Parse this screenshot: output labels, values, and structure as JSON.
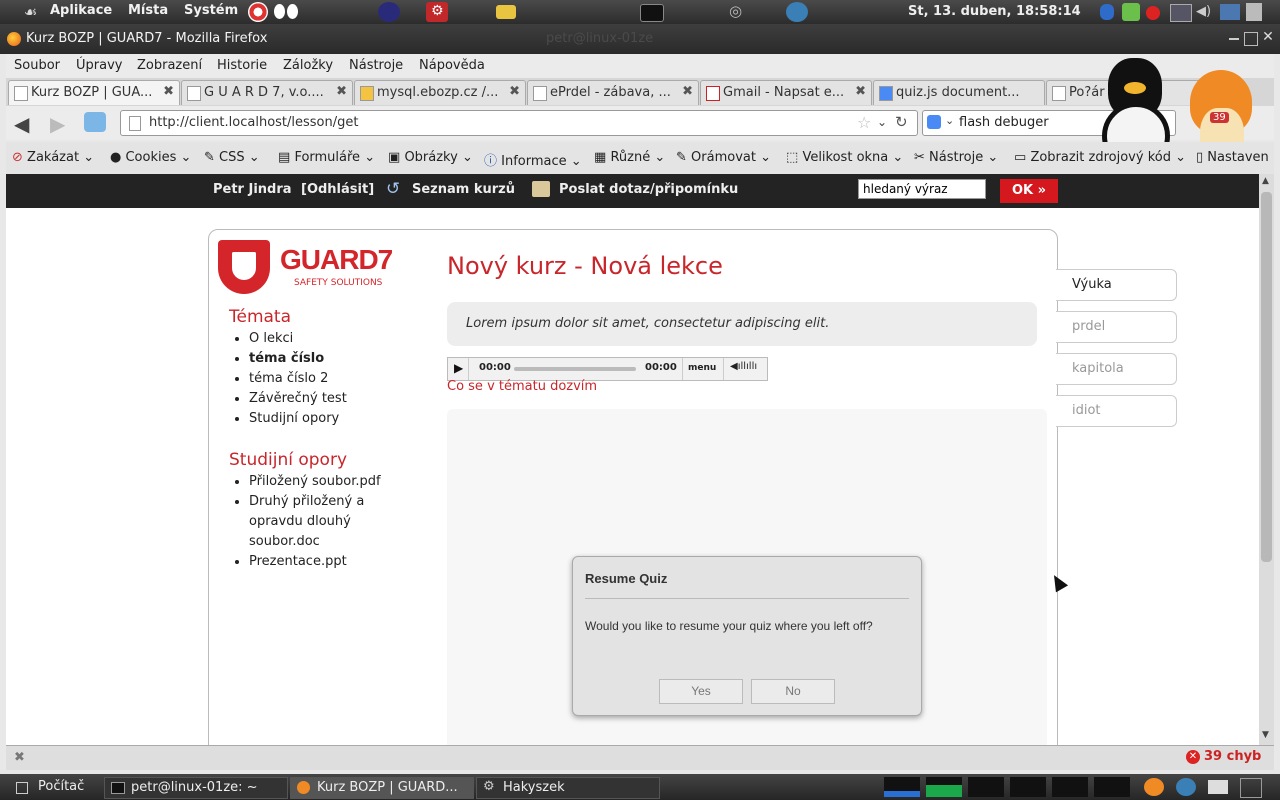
{
  "top_panel": {
    "menus": [
      "Aplikace",
      "Místa",
      "Systém"
    ],
    "clock": "St, 13. duben, 18:58:14"
  },
  "window": {
    "title": "Kurz BOZP | GUARD7 - Mozilla Firefox"
  },
  "menubar": [
    "Soubor",
    "Úpravy",
    "Zobrazení",
    "Historie",
    "Záložky",
    "Nástroje",
    "Nápověda"
  ],
  "tabs": [
    {
      "label": "Kurz BOZP | GUA...",
      "active": true
    },
    {
      "label": "G U A R D 7, v.o...."
    },
    {
      "label": "mysql.ebozp.cz /..."
    },
    {
      "label": "ePrdel - zábava, ..."
    },
    {
      "label": "Gmail - Napsat e..."
    },
    {
      "label": "quiz.js document..."
    },
    {
      "label": "Po?ár"
    }
  ],
  "nav": {
    "url": "http://client.localhost/lesson/get",
    "search": "flash debuger"
  },
  "webdev_toolbar": [
    "Zakázat",
    "Cookies",
    "CSS",
    "Formuláře",
    "Obrázky",
    "Informace",
    "Různé",
    "Orámovat",
    "Velikost okna",
    "Nástroje",
    "Zobrazit zdrojový kód",
    "Nastaven"
  ],
  "site_header": {
    "user": "Petr Jindra",
    "logout": "[Odhlásit]",
    "courses": "Seznam kurzů",
    "ask": "Poslat dotaz/připomínku",
    "search_value": "hledaný výraz",
    "search_button": "OK »"
  },
  "logo": {
    "name": "GUARD7",
    "tagline": "SAFETY SOLUTIONS"
  },
  "sidebar": {
    "topics_heading": "Témata",
    "topics": [
      "O lekci",
      "téma číslo",
      "téma číslo 2",
      "Závěrečný test",
      "Studijní opory"
    ],
    "materials_heading": "Studijní opory",
    "materials": [
      "Přiložený soubor.pdf",
      "Druhý přiložený a opravdu dlouhý soubor.doc",
      "Prezentace.ppt"
    ]
  },
  "lesson": {
    "title": "Nový kurz - Nová lekce",
    "intro": "Lorem ipsum dolor sit amet, consectetur adipiscing elit.",
    "player": {
      "time_current": "00:00",
      "time_total": "00:00",
      "menu": "menu"
    },
    "link": "Co se v tématu dozvím"
  },
  "side_tabs": [
    "Výuka",
    "prdel",
    "kapitola",
    "idiot"
  ],
  "dialog": {
    "title": "Resume Quiz",
    "message": "Would you like to resume your quiz where you left off?",
    "yes": "Yes",
    "no": "No"
  },
  "statusbar": {
    "errors": "39 chyb"
  },
  "taskbar": [
    "Počítač",
    "petr@linux-01ze: ~",
    "Kurz BOZP | GUARD...",
    "Hakyszek"
  ],
  "badge_count": "39"
}
